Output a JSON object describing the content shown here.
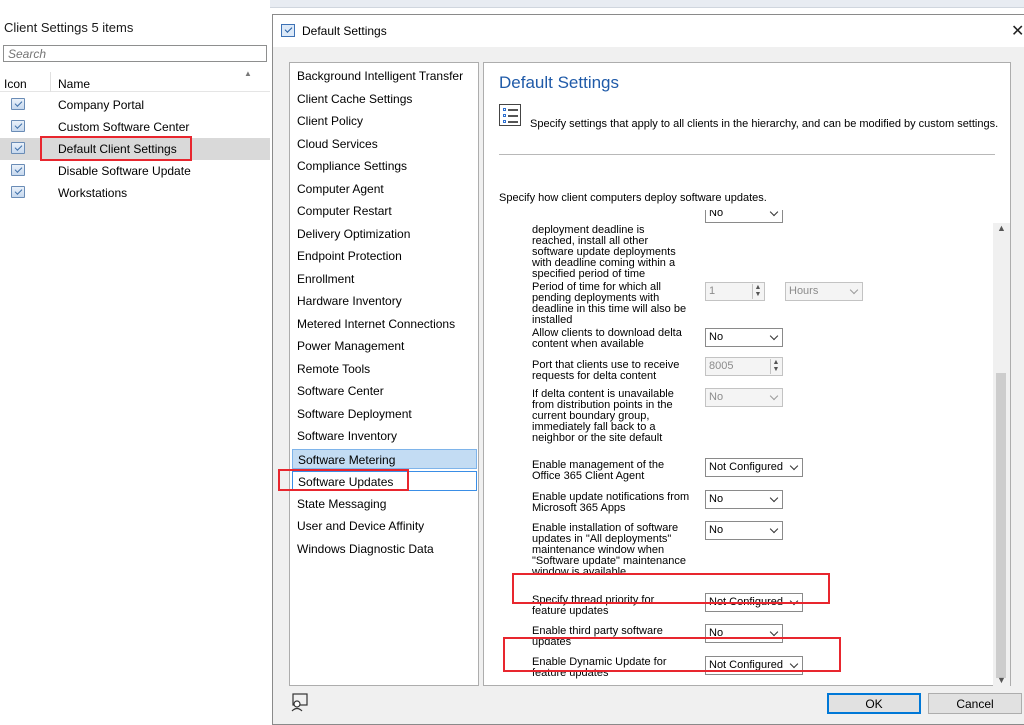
{
  "left": {
    "header_title": "Client Settings",
    "header_count": "5 items",
    "search_placeholder": "Search",
    "col_icon": "Icon",
    "col_name": "Name",
    "items": [
      {
        "label": "Company Portal"
      },
      {
        "label": "Custom Software Center"
      },
      {
        "label": "Default Client Settings"
      },
      {
        "label": "Disable Software Update"
      },
      {
        "label": "Workstations"
      }
    ]
  },
  "dialog": {
    "title": "Default Settings",
    "close_glyph": "✕",
    "nav": [
      "Background Intelligent Transfer",
      "Client Cache Settings",
      "Client Policy",
      "Cloud Services",
      "Compliance Settings",
      "Computer Agent",
      "Computer Restart",
      "Delivery Optimization",
      "Endpoint Protection",
      "Enrollment",
      "Hardware Inventory",
      "Metered Internet Connections",
      "Power Management",
      "Remote Tools",
      "Software Center",
      "Software Deployment",
      "Software Inventory",
      "Software Metering",
      "Software Updates",
      "State Messaging",
      "User and Device Affinity",
      "Windows Diagnostic Data"
    ],
    "panel": {
      "heading": "Default Settings",
      "description": "Specify settings that apply to all clients in the hierarchy, and can be modified by custom settings.",
      "subheading": "Specify how client computers deploy software updates.",
      "settings": [
        {
          "label": "deployment deadline is reached, install all other software update deployments with deadline coming within a specified period of time",
          "value": "No"
        },
        {
          "label": "Period of time for which all pending deployments with deadline in this time will also be installed",
          "value": "1",
          "unit": "Hours"
        },
        {
          "label": "Allow clients to download delta content when available",
          "value": "No"
        },
        {
          "label": "Port that clients use to receive requests for delta content",
          "value": "8005"
        },
        {
          "label": "If delta content is unavailable from distribution points in the current boundary group, immediately fall back to a neighbor or the site default",
          "value": "No"
        },
        {
          "label": "Enable management of the Office 365 Client Agent",
          "value": "Not Configured"
        },
        {
          "label": "Enable update notifications from Microsoft 365 Apps",
          "value": "No"
        },
        {
          "label": "Enable installation of software updates in \"All deployments\" maintenance window when \"Software update\" maintenance window is available",
          "value": "No"
        },
        {
          "label": "Specify thread priority for feature updates",
          "value": "Not Configured"
        },
        {
          "label": "Enable third party software updates",
          "value": "No"
        },
        {
          "label": "Enable Dynamic Update for feature updates",
          "value": "Not Configured"
        }
      ]
    },
    "ok_label": "OK",
    "cancel_label": "Cancel"
  },
  "colors": {
    "annotation": "#e8262e",
    "heading_blue": "#1f5aa8",
    "selection": "#c3dcf3"
  }
}
